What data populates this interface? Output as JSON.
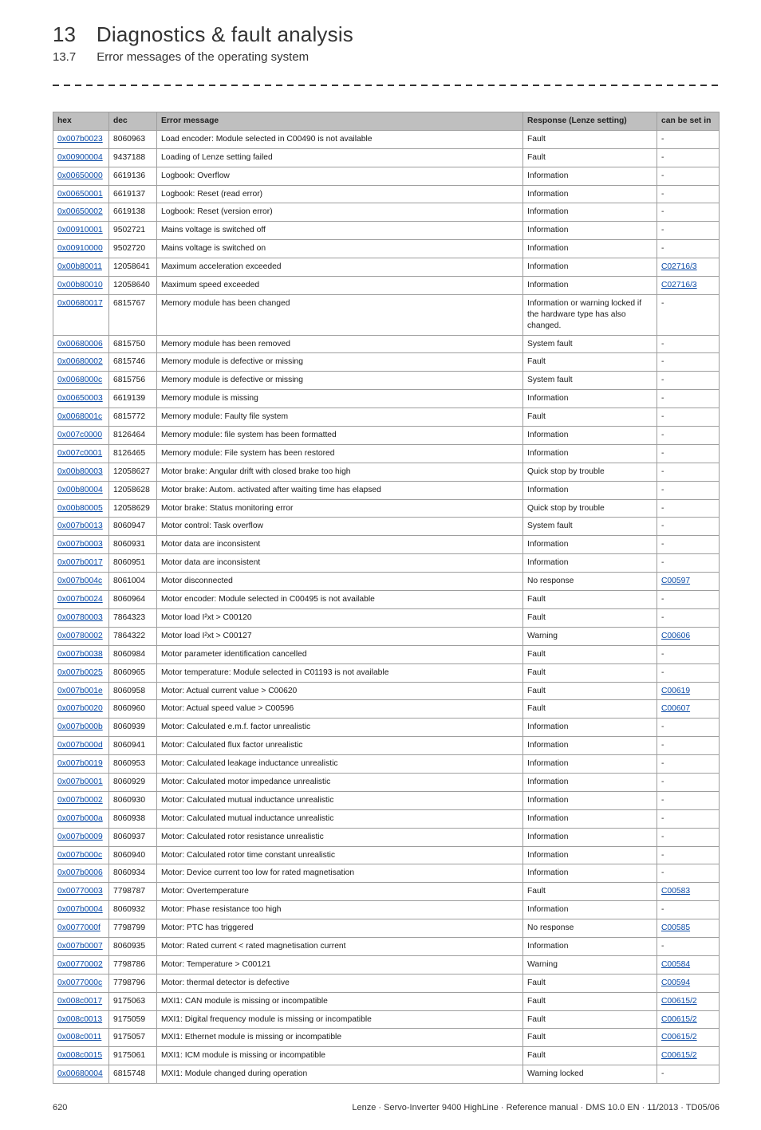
{
  "heading": {
    "chapter_num": "13",
    "chapter_title": "Diagnostics & fault analysis"
  },
  "subheading": {
    "section_num": "13.7",
    "section_title": "Error messages of the operating system"
  },
  "table": {
    "headers": {
      "hex": "hex",
      "dec": "dec",
      "msg": "Error message",
      "resp": "Response (Lenze setting)",
      "set": "can be set in"
    },
    "rows": [
      {
        "hex": "0x007b0023",
        "dec": "8060963",
        "msg": "Load encoder: Module selected in C00490 is not available",
        "resp": "Fault",
        "set": "-"
      },
      {
        "hex": "0x00900004",
        "dec": "9437188",
        "msg": "Loading of Lenze setting failed",
        "resp": "Fault",
        "set": "-"
      },
      {
        "hex": "0x00650000",
        "dec": "6619136",
        "msg": "Logbook: Overflow",
        "resp": "Information",
        "set": "-"
      },
      {
        "hex": "0x00650001",
        "dec": "6619137",
        "msg": "Logbook: Reset (read error)",
        "resp": "Information",
        "set": "-"
      },
      {
        "hex": "0x00650002",
        "dec": "6619138",
        "msg": "Logbook: Reset (version error)",
        "resp": "Information",
        "set": "-"
      },
      {
        "hex": "0x00910001",
        "dec": "9502721",
        "msg": "Mains voltage is switched off",
        "resp": "Information",
        "set": "-"
      },
      {
        "hex": "0x00910000",
        "dec": "9502720",
        "msg": "Mains voltage is switched on",
        "resp": "Information",
        "set": "-"
      },
      {
        "hex": "0x00b80011",
        "dec": "12058641",
        "msg": "Maximum acceleration exceeded",
        "resp": "Information",
        "set": "C02716/3",
        "set_link": true
      },
      {
        "hex": "0x00b80010",
        "dec": "12058640",
        "msg": "Maximum speed exceeded",
        "resp": "Information",
        "set": "C02716/3",
        "set_link": true
      },
      {
        "hex": "0x00680017",
        "dec": "6815767",
        "msg": "Memory module has been changed",
        "resp": "Information or warning locked if the hardware type has also changed.",
        "set": "-"
      },
      {
        "hex": "0x00680006",
        "dec": "6815750",
        "msg": "Memory module has been removed",
        "resp": "System fault",
        "set": "-"
      },
      {
        "hex": "0x00680002",
        "dec": "6815746",
        "msg": "Memory module is defective or missing",
        "resp": "Fault",
        "set": "-"
      },
      {
        "hex": "0x0068000c",
        "dec": "6815756",
        "msg": "Memory module is defective or missing",
        "resp": "System fault",
        "set": "-"
      },
      {
        "hex": "0x00650003",
        "dec": "6619139",
        "msg": "Memory module is missing",
        "resp": "Information",
        "set": "-"
      },
      {
        "hex": "0x0068001c",
        "dec": "6815772",
        "msg": "Memory module: Faulty file system",
        "resp": "Fault",
        "set": "-"
      },
      {
        "hex": "0x007c0000",
        "dec": "8126464",
        "msg": "Memory module: file system has been formatted",
        "resp": "Information",
        "set": "-"
      },
      {
        "hex": "0x007c0001",
        "dec": "8126465",
        "msg": "Memory module: File system has been restored",
        "resp": "Information",
        "set": "-"
      },
      {
        "hex": "0x00b80003",
        "dec": "12058627",
        "msg": "Motor brake: Angular drift with closed brake too high",
        "resp": "Quick stop by trouble",
        "set": "-"
      },
      {
        "hex": "0x00b80004",
        "dec": "12058628",
        "msg": "Motor brake: Autom. activated after waiting time has elapsed",
        "resp": "Information",
        "set": "-"
      },
      {
        "hex": "0x00b80005",
        "dec": "12058629",
        "msg": "Motor brake: Status monitoring error",
        "resp": "Quick stop by trouble",
        "set": "-"
      },
      {
        "hex": "0x007b0013",
        "dec": "8060947",
        "msg": "Motor control: Task overflow",
        "resp": "System fault",
        "set": "-"
      },
      {
        "hex": "0x007b0003",
        "dec": "8060931",
        "msg": "Motor data are inconsistent",
        "resp": "Information",
        "set": "-"
      },
      {
        "hex": "0x007b0017",
        "dec": "8060951",
        "msg": "Motor data are inconsistent",
        "resp": "Information",
        "set": "-"
      },
      {
        "hex": "0x007b004c",
        "dec": "8061004",
        "msg": "Motor disconnected",
        "resp": "No response",
        "set": "C00597",
        "set_link": true
      },
      {
        "hex": "0x007b0024",
        "dec": "8060964",
        "msg": "Motor encoder: Module selected in C00495 is not available",
        "resp": "Fault",
        "set": "-"
      },
      {
        "hex": "0x00780003",
        "dec": "7864323",
        "msg": "Motor load I²xt > C00120",
        "resp": "Fault",
        "set": "-"
      },
      {
        "hex": "0x00780002",
        "dec": "7864322",
        "msg": "Motor load I²xt > C00127",
        "resp": "Warning",
        "set": "C00606",
        "set_link": true
      },
      {
        "hex": "0x007b0038",
        "dec": "8060984",
        "msg": "Motor parameter identification cancelled",
        "resp": "Fault",
        "set": "-"
      },
      {
        "hex": "0x007b0025",
        "dec": "8060965",
        "msg": "Motor temperature: Module selected in C01193 is not available",
        "resp": "Fault",
        "set": "-"
      },
      {
        "hex": "0x007b001e",
        "dec": "8060958",
        "msg": "Motor: Actual current value > C00620",
        "resp": "Fault",
        "set": "C00619",
        "set_link": true
      },
      {
        "hex": "0x007b0020",
        "dec": "8060960",
        "msg": "Motor: Actual speed value > C00596",
        "resp": "Fault",
        "set": "C00607",
        "set_link": true
      },
      {
        "hex": "0x007b000b",
        "dec": "8060939",
        "msg": "Motor: Calculated e.m.f. factor unrealistic",
        "resp": "Information",
        "set": "-"
      },
      {
        "hex": "0x007b000d",
        "dec": "8060941",
        "msg": "Motor: Calculated flux factor unrealistic",
        "resp": "Information",
        "set": "-"
      },
      {
        "hex": "0x007b0019",
        "dec": "8060953",
        "msg": "Motor: Calculated leakage inductance unrealistic",
        "resp": "Information",
        "set": "-"
      },
      {
        "hex": "0x007b0001",
        "dec": "8060929",
        "msg": "Motor: Calculated motor impedance unrealistic",
        "resp": "Information",
        "set": "-"
      },
      {
        "hex": "0x007b0002",
        "dec": "8060930",
        "msg": "Motor: Calculated mutual inductance unrealistic",
        "resp": "Information",
        "set": "-"
      },
      {
        "hex": "0x007b000a",
        "dec": "8060938",
        "msg": "Motor: Calculated mutual inductance unrealistic",
        "resp": "Information",
        "set": "-"
      },
      {
        "hex": "0x007b0009",
        "dec": "8060937",
        "msg": "Motor: Calculated rotor resistance unrealistic",
        "resp": "Information",
        "set": "-"
      },
      {
        "hex": "0x007b000c",
        "dec": "8060940",
        "msg": "Motor: Calculated rotor time constant unrealistic",
        "resp": "Information",
        "set": "-"
      },
      {
        "hex": "0x007b0006",
        "dec": "8060934",
        "msg": "Motor: Device current too low for rated magnetisation",
        "resp": "Information",
        "set": "-"
      },
      {
        "hex": "0x00770003",
        "dec": "7798787",
        "msg": "Motor: Overtemperature",
        "resp": "Fault",
        "set": "C00583",
        "set_link": true
      },
      {
        "hex": "0x007b0004",
        "dec": "8060932",
        "msg": "Motor: Phase resistance too high",
        "resp": "Information",
        "set": "-"
      },
      {
        "hex": "0x0077000f",
        "dec": "7798799",
        "msg": "Motor: PTC has triggered",
        "resp": "No response",
        "set": "C00585",
        "set_link": true
      },
      {
        "hex": "0x007b0007",
        "dec": "8060935",
        "msg": "Motor: Rated current < rated magnetisation current",
        "resp": "Information",
        "set": "-"
      },
      {
        "hex": "0x00770002",
        "dec": "7798786",
        "msg": "Motor: Temperature > C00121",
        "resp": "Warning",
        "set": "C00584",
        "set_link": true
      },
      {
        "hex": "0x0077000c",
        "dec": "7798796",
        "msg": "Motor: thermal detector is defective",
        "resp": "Fault",
        "set": "C00594",
        "set_link": true
      },
      {
        "hex": "0x008c0017",
        "dec": "9175063",
        "msg": "MXI1: CAN module is missing or incompatible",
        "resp": "Fault",
        "set": "C00615/2",
        "set_link": true
      },
      {
        "hex": "0x008c0013",
        "dec": "9175059",
        "msg": "MXI1: Digital frequency module is missing or incompatible",
        "resp": "Fault",
        "set": "C00615/2",
        "set_link": true
      },
      {
        "hex": "0x008c0011",
        "dec": "9175057",
        "msg": "MXI1: Ethernet module is missing or incompatible",
        "resp": "Fault",
        "set": "C00615/2",
        "set_link": true
      },
      {
        "hex": "0x008c0015",
        "dec": "9175061",
        "msg": "MXI1: ICM module is missing or incompatible",
        "resp": "Fault",
        "set": "C00615/2",
        "set_link": true
      },
      {
        "hex": "0x00680004",
        "dec": "6815748",
        "msg": "MXI1: Module changed during operation",
        "resp": "Warning locked",
        "set": "-"
      }
    ]
  },
  "footer": {
    "page": "620",
    "note": "Lenze · Servo-Inverter 9400 HighLine · Reference manual · DMS 10.0 EN · 11/2013 · TD05/06"
  }
}
